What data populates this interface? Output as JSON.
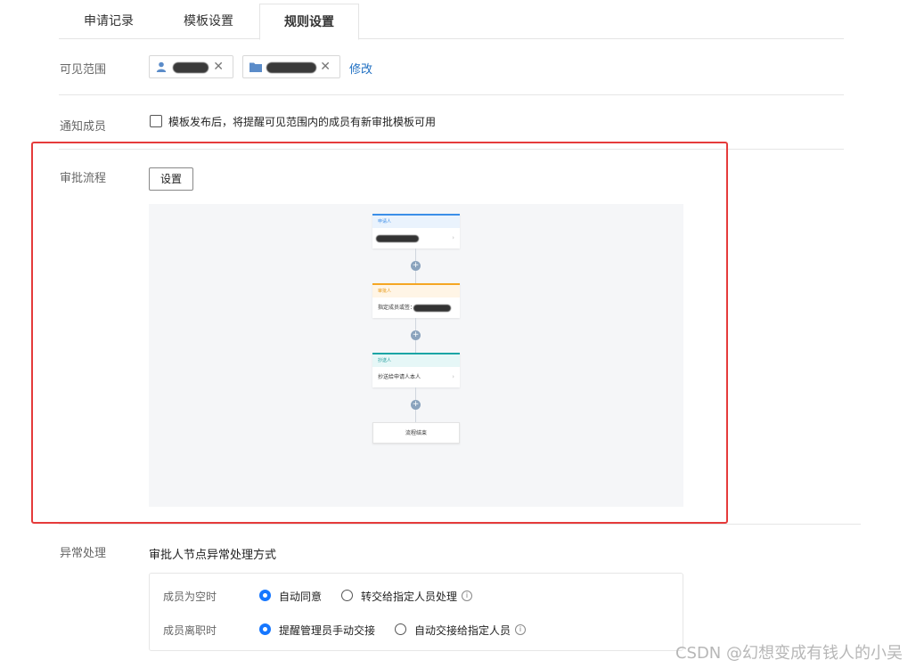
{
  "tabs": [
    {
      "label": "申请记录"
    },
    {
      "label": "模板设置"
    },
    {
      "label": "规则设置",
      "active": true
    }
  ],
  "visible_range": {
    "label": "可见范围",
    "modify_link": "修改",
    "close_glyph": "✕",
    "chips": [
      {
        "icon": "user-icon",
        "text": ""
      },
      {
        "icon": "folder-icon",
        "text": ""
      }
    ]
  },
  "notify": {
    "label": "通知成员",
    "checkbox_text": "模板发布后，将提醒可见范围内的成员有新审批模板可用",
    "checked": false
  },
  "approval_flow": {
    "label": "审批流程",
    "settings_button": "设置",
    "nodes": [
      {
        "header": "申请人",
        "body": "",
        "color": "#3b8ee8"
      },
      {
        "header": "审批人",
        "body": "指定成员或签：",
        "color": "#f5a623"
      },
      {
        "header": "抄送人",
        "body": "抄送给申请人本人",
        "color": "#1aa5a5"
      }
    ],
    "end_node": "流程结束",
    "add_glyph": "+",
    "chevron_glyph": "›"
  },
  "exception": {
    "label": "异常处理",
    "subtitle": "审批人节点异常处理方式",
    "info_glyph": "i",
    "rows": [
      {
        "label": "成员为空时",
        "options": [
          {
            "text": "自动同意",
            "selected": true
          },
          {
            "text": "转交给指定人员处理",
            "selected": false,
            "info": true
          }
        ]
      },
      {
        "label": "成员离职时",
        "options": [
          {
            "text": "提醒管理员手动交接",
            "selected": true
          },
          {
            "text": "自动交接给指定人员",
            "selected": false,
            "info": true
          }
        ]
      }
    ]
  },
  "accent_color": "#1677ff",
  "highlight_color": "#e53b3b",
  "watermark": "CSDN @幻想变成有钱人的小吴"
}
